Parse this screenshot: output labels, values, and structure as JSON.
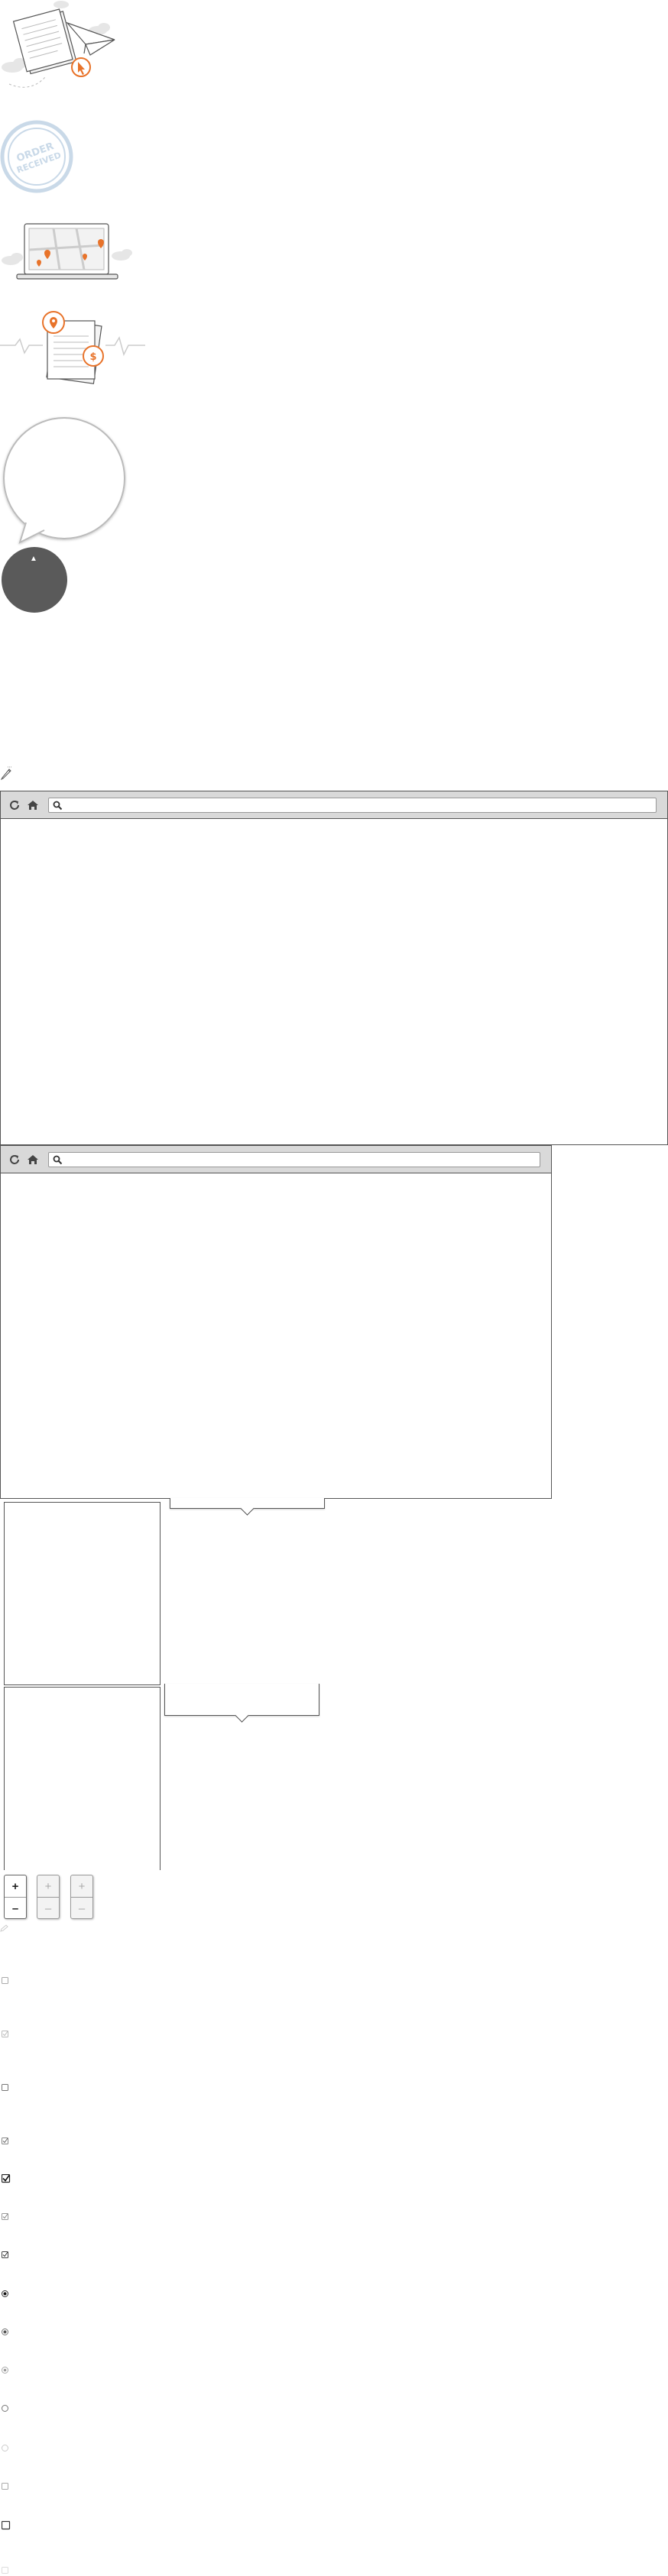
{
  "illustrations": {
    "order_stamp_text": "ORDER RECEIVED",
    "price_badge": "$",
    "speech_bubble": "",
    "knob_arrow": "▲"
  },
  "browsers": [
    {
      "search_placeholder": ""
    },
    {
      "search_placeholder": ""
    }
  ],
  "stepper_labels": {
    "plus": "+",
    "minus": "–"
  },
  "icons": [
    "reload-icon",
    "home-icon",
    "search-icon",
    "pencil-icon",
    "checkbox-icon",
    "radio-icon"
  ],
  "colors": {
    "accent": "#e8732a",
    "stamp": "#c9d9e8",
    "border": "#555555",
    "toolbar": "#d9d9d9",
    "knob": "#5a5a5a"
  }
}
